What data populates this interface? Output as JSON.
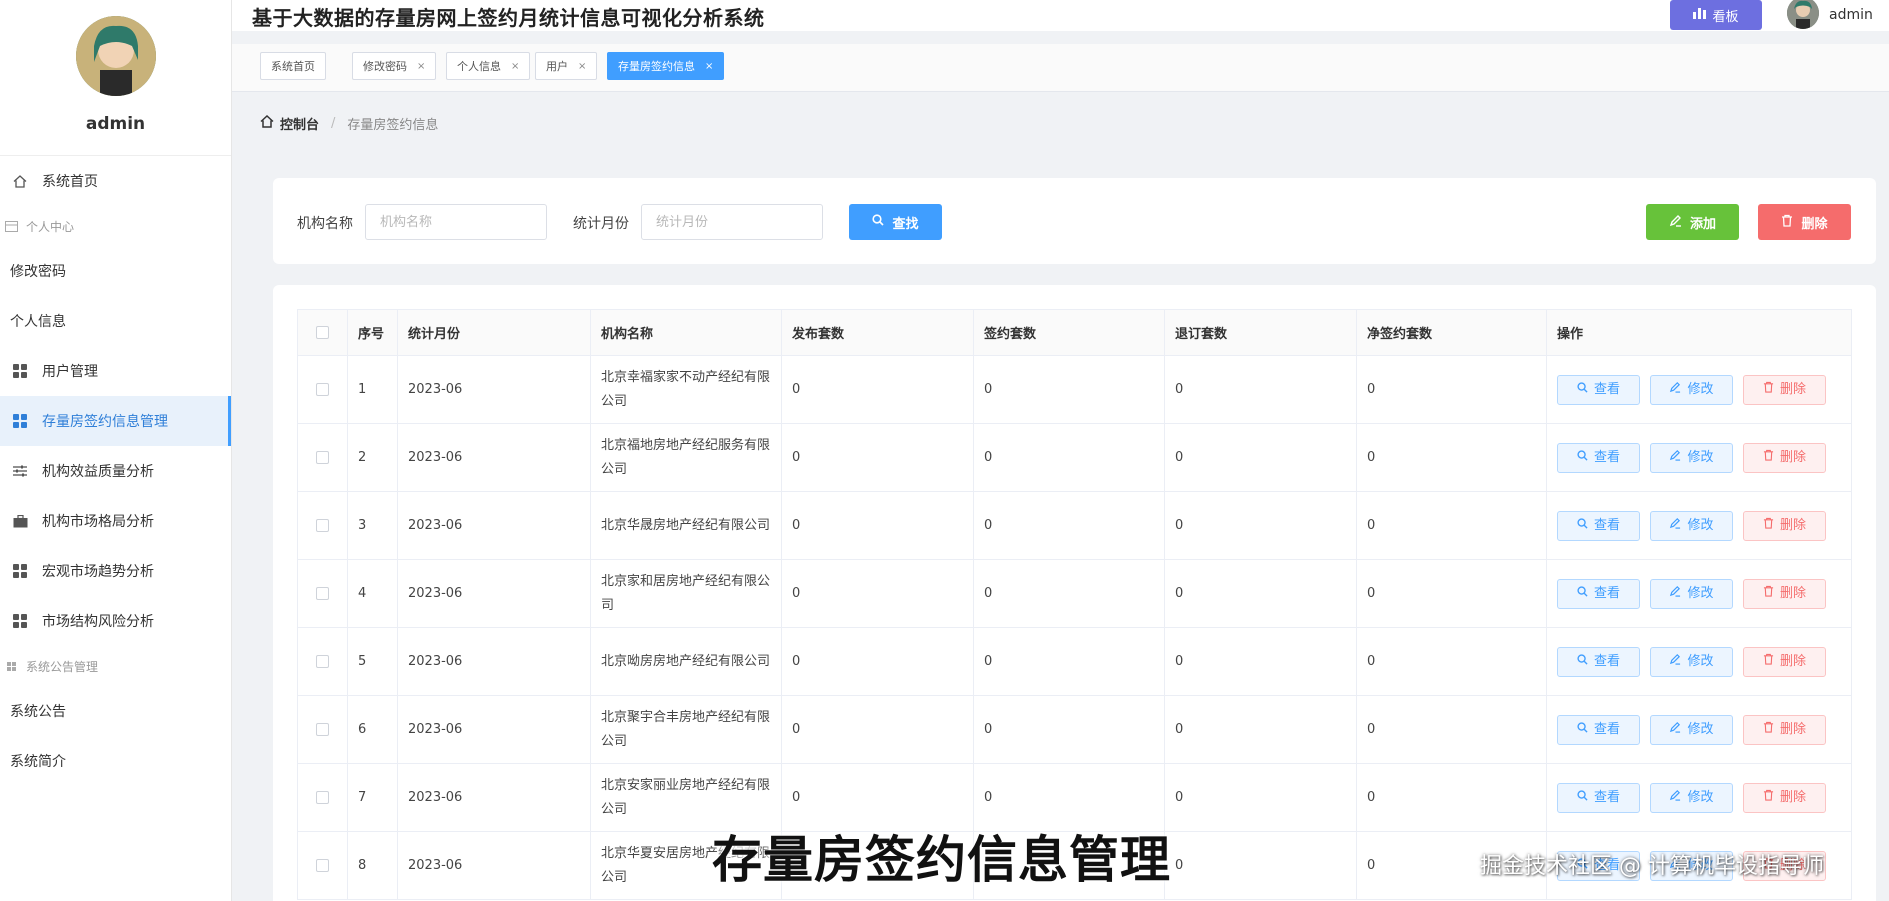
{
  "app": {
    "title": "基于大数据的存量房网上签约月统计信息可视化分析系统"
  },
  "header": {
    "board_label": "看板",
    "username": "admin"
  },
  "sidebar": {
    "username": "admin",
    "items": [
      {
        "label": "系统首页",
        "type": "item",
        "icon": "home-icon"
      },
      {
        "label": "个人中心",
        "type": "group",
        "icon": "card-icon"
      },
      {
        "label": "修改密码",
        "type": "plain"
      },
      {
        "label": "个人信息",
        "type": "plain"
      },
      {
        "label": "用户管理",
        "type": "item",
        "icon": "grid-icon"
      },
      {
        "label": "存量房签约信息管理",
        "type": "item",
        "icon": "grid-icon",
        "active": true
      },
      {
        "label": "机构效益质量分析",
        "type": "item",
        "icon": "sliders-icon"
      },
      {
        "label": "机构市场格局分析",
        "type": "item",
        "icon": "briefcase-icon"
      },
      {
        "label": "宏观市场趋势分析",
        "type": "item",
        "icon": "grid-icon"
      },
      {
        "label": "市场结构风险分析",
        "type": "item",
        "icon": "grid-icon"
      },
      {
        "label": "系统公告管理",
        "type": "group",
        "icon": "grid-icon"
      },
      {
        "label": "系统公告",
        "type": "plain"
      },
      {
        "label": "系统简介",
        "type": "plain"
      }
    ]
  },
  "tags": [
    {
      "label": "系统首页",
      "closable": false
    },
    {
      "label": "修改密码",
      "closable": true
    },
    {
      "label": "个人信息",
      "closable": true
    },
    {
      "label": "用户",
      "closable": true
    },
    {
      "label": "存量房签约信息",
      "closable": true,
      "active": true
    }
  ],
  "breadcrumb": {
    "home": "控制台",
    "current": "存量房签约信息"
  },
  "search": {
    "org_label": "机构名称",
    "org_placeholder": "机构名称",
    "month_label": "统计月份",
    "month_placeholder": "统计月份",
    "search_btn": "查找",
    "add_btn": "添加",
    "delete_btn": "删除"
  },
  "table": {
    "headers": [
      "序号",
      "统计月份",
      "机构名称",
      "发布套数",
      "签约套数",
      "退订套数",
      "净签约套数",
      "操作"
    ],
    "actions": {
      "view": "查看",
      "edit": "修改",
      "delete": "删除"
    },
    "rows": [
      {
        "no": "1",
        "month": "2023-06",
        "org": "北京幸福家家不动产经纪有限公司",
        "published": "0",
        "signed": "0",
        "cancelled": "0",
        "net": "0"
      },
      {
        "no": "2",
        "month": "2023-06",
        "org": "北京福地房地产经纪服务有限公司",
        "published": "0",
        "signed": "0",
        "cancelled": "0",
        "net": "0"
      },
      {
        "no": "3",
        "month": "2023-06",
        "org": "北京华晟房地产经纪有限公司",
        "published": "0",
        "signed": "0",
        "cancelled": "0",
        "net": "0"
      },
      {
        "no": "4",
        "month": "2023-06",
        "org": "北京家和居房地产经纪有限公司",
        "published": "0",
        "signed": "0",
        "cancelled": "0",
        "net": "0"
      },
      {
        "no": "5",
        "month": "2023-06",
        "org": "北京呦房房地产经纪有限公司",
        "published": "0",
        "signed": "0",
        "cancelled": "0",
        "net": "0"
      },
      {
        "no": "6",
        "month": "2023-06",
        "org": "北京聚宇合丰房地产经纪有限公司",
        "published": "0",
        "signed": "0",
        "cancelled": "0",
        "net": "0"
      },
      {
        "no": "7",
        "month": "2023-06",
        "org": "北京安家丽业房地产经纪有限公司",
        "published": "0",
        "signed": "0",
        "cancelled": "0",
        "net": "0"
      },
      {
        "no": "8",
        "month": "2023-06",
        "org": "北京华夏安居房地产经纪有限公司",
        "published": "",
        "signed": "",
        "cancelled": "0",
        "net": "0"
      }
    ]
  },
  "overlay": {
    "caption": "存量房签约信息管理",
    "watermark": "掘金技术社区 @ 计算机毕设指导师"
  },
  "colors": {
    "primary": "#409eff",
    "success": "#67c23a",
    "danger": "#f56c6c",
    "board": "#6d6fe0"
  }
}
